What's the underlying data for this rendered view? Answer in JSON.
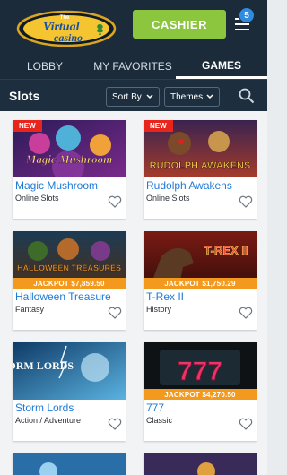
{
  "header": {
    "logo_text_small": "The",
    "logo_text_main": "Virtual",
    "logo_text_sub": "casino",
    "cashier_label": "CASHIER",
    "notification_count": "5"
  },
  "tabs": [
    {
      "label": "LOBBY",
      "active": false
    },
    {
      "label": "MY FAVORITES",
      "active": false
    },
    {
      "label": "GAMES",
      "active": true
    }
  ],
  "filter": {
    "title": "Slots",
    "sort_label": "Sort By",
    "themes_label": "Themes"
  },
  "games": [
    {
      "name": "Magic Mushroom",
      "category": "Online Slots",
      "badge": "NEW",
      "jackpot": "",
      "art_text": "Magic Mushroom"
    },
    {
      "name": "Rudolph Awakens",
      "category": "Online Slots",
      "badge": "NEW",
      "jackpot": "",
      "art_text": "RUDOLPH AWAKENS"
    },
    {
      "name": "Halloween Treasure",
      "category": "Fantasy",
      "badge": "",
      "jackpot": "JACKPOT $7,859.50",
      "art_text": "HALLOWEEN TREASURES"
    },
    {
      "name": "T-Rex II",
      "category": "History",
      "badge": "",
      "jackpot": "JACKPOT $1,750.29",
      "art_text": "T-REX II"
    },
    {
      "name": "Storm Lords",
      "category": "Action / Adventure",
      "badge": "",
      "jackpot": "",
      "art_text": "STORM LORDS"
    },
    {
      "name": "777",
      "category": "Classic",
      "badge": "",
      "jackpot": "JACKPOT $4,270.50",
      "art_text": "777"
    }
  ],
  "colors": {
    "header_bg": "#1b2b3a",
    "cashier_green": "#8cc63f",
    "link_blue": "#1f7ad6",
    "new_red": "#e8251c",
    "jackpot_orange": "#f39a1e",
    "badge_blue": "#2e8be0"
  }
}
